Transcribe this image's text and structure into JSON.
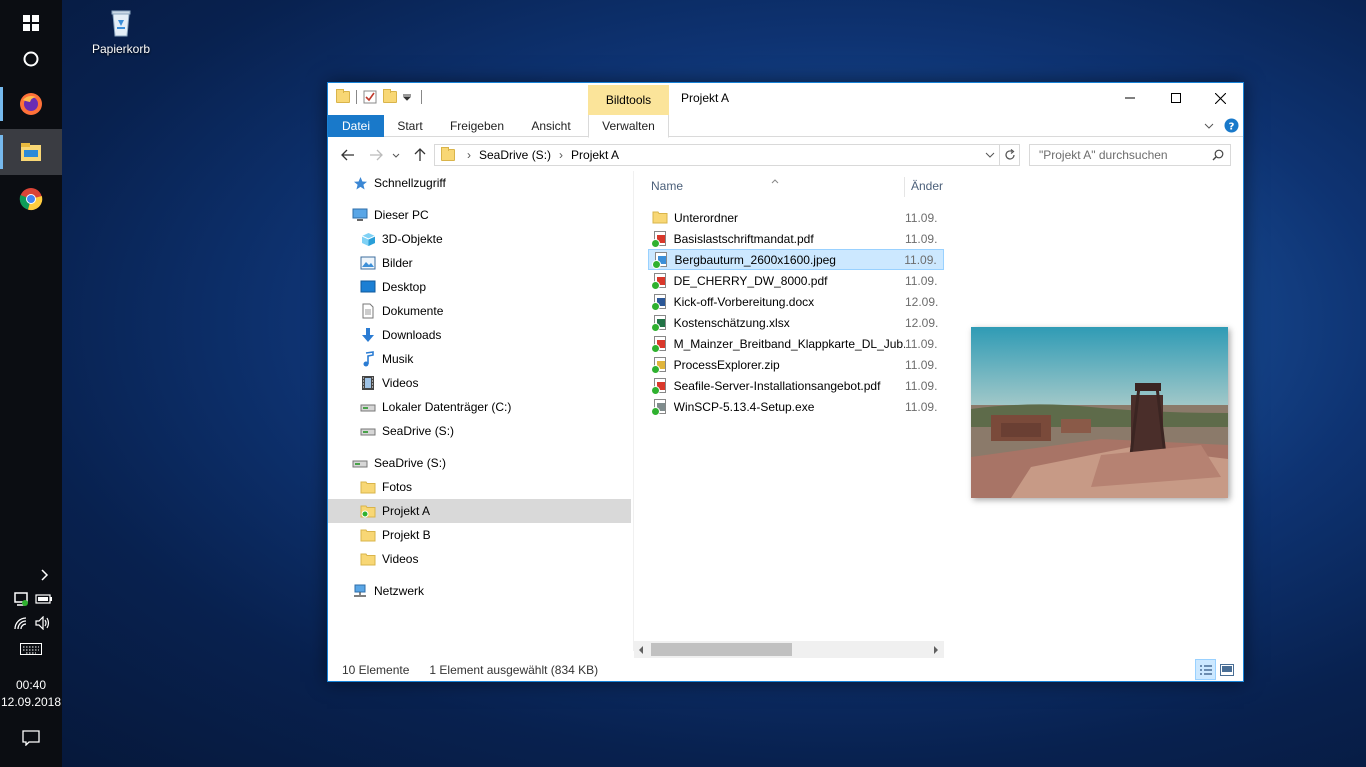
{
  "desktop": {
    "recycle_bin_label": "Papierkorb"
  },
  "taskbar": {
    "clock_time": "00:40",
    "clock_date": "12.09.2018",
    "apps": [
      "start",
      "cortana",
      "firefox",
      "file-explorer",
      "chrome"
    ]
  },
  "window": {
    "title": "Projekt A",
    "contextual_group": "Bildtools",
    "ribbon_tabs": [
      "Datei",
      "Start",
      "Freigeben",
      "Ansicht",
      "Verwalten"
    ],
    "accent_color": "#1979ca"
  },
  "address": {
    "crumbs": [
      "SeaDrive (S:)",
      "Projekt A"
    ],
    "search_placeholder": "\"Projekt A\" durchsuchen"
  },
  "nav": {
    "items": [
      {
        "label": "Schnellzugriff",
        "icon": "star-icon",
        "level": 0
      },
      {
        "label": "Dieser PC",
        "icon": "computer-icon",
        "level": 0
      },
      {
        "label": "3D-Objekte",
        "icon": "cube-icon",
        "level": 1
      },
      {
        "label": "Bilder",
        "icon": "pictures-icon",
        "level": 1
      },
      {
        "label": "Desktop",
        "icon": "desktop-icon",
        "level": 1
      },
      {
        "label": "Dokumente",
        "icon": "documents-icon",
        "level": 1
      },
      {
        "label": "Downloads",
        "icon": "download-arrow-icon",
        "level": 1
      },
      {
        "label": "Musik",
        "icon": "music-note-icon",
        "level": 1
      },
      {
        "label": "Videos",
        "icon": "video-film-icon",
        "level": 1
      },
      {
        "label": "Lokaler Datenträger (C:)",
        "icon": "drive-icon",
        "level": 1
      },
      {
        "label": "SeaDrive (S:)",
        "icon": "drive-icon",
        "level": 1
      },
      {
        "label": "SeaDrive (S:)",
        "icon": "drive-icon",
        "level": 0
      },
      {
        "label": "Fotos",
        "icon": "folder-icon",
        "level": 1
      },
      {
        "label": "Projekt A",
        "icon": "folder-synced-icon",
        "level": 1
      },
      {
        "label": "Projekt B",
        "icon": "folder-icon",
        "level": 1
      },
      {
        "label": "Videos",
        "icon": "folder-icon",
        "level": 1
      },
      {
        "label": "Netzwerk",
        "icon": "network-icon",
        "level": 0
      }
    ]
  },
  "files": {
    "columns": [
      "Name",
      "Änder"
    ],
    "rows": [
      {
        "name": "Unterordner",
        "date": "11.09.",
        "type": "folder"
      },
      {
        "name": "Basislastschriftmandat.pdf",
        "date": "11.09.",
        "type": "pdf"
      },
      {
        "name": "Bergbauturm_2600x1600.jpeg",
        "date": "11.09.",
        "type": "image",
        "selected": true
      },
      {
        "name": "DE_CHERRY_DW_8000.pdf",
        "date": "11.09.",
        "type": "pdf"
      },
      {
        "name": "Kick-off-Vorbereitung.docx",
        "date": "12.09.",
        "type": "docx"
      },
      {
        "name": "Kostenschätzung.xlsx",
        "date": "12.09.",
        "type": "xlsx"
      },
      {
        "name": "M_Mainzer_Breitband_Klappkarte_DL_Jub...",
        "date": "11.09.",
        "type": "pdf"
      },
      {
        "name": "ProcessExplorer.zip",
        "date": "11.09.",
        "type": "zip"
      },
      {
        "name": "Seafile-Server-Installationsangebot.pdf",
        "date": "11.09.",
        "type": "pdf"
      },
      {
        "name": "WinSCP-5.13.4-Setup.exe",
        "date": "11.09.",
        "type": "exe"
      }
    ]
  },
  "status": {
    "count": "10 Elemente",
    "selection": "1 Element ausgewählt (834 KB)"
  }
}
